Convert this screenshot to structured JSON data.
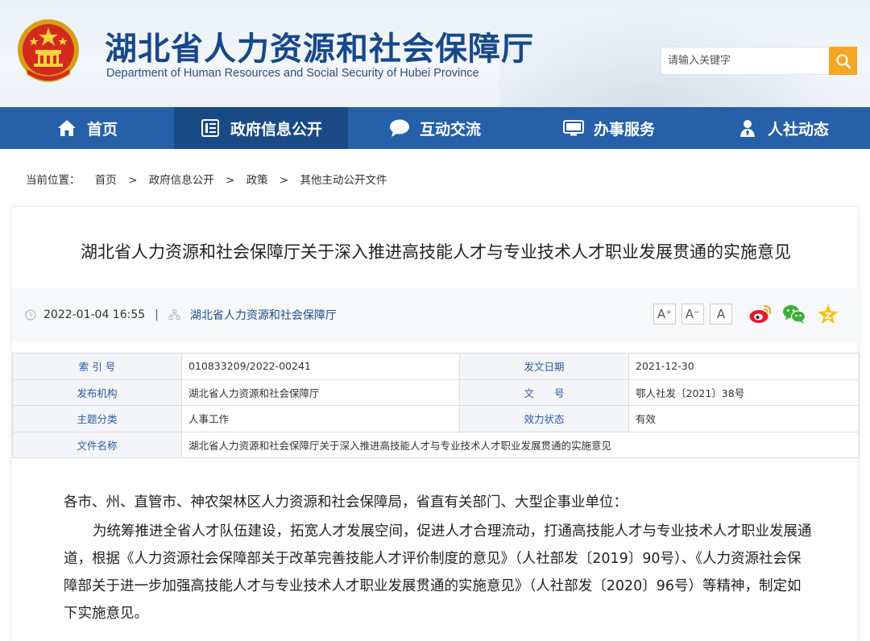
{
  "site": {
    "title": "湖北省人力资源和社会保障厅",
    "subtitle": "Department of Human Resources and Social Security of Hubei Province"
  },
  "search": {
    "placeholder": "请输入关键字"
  },
  "nav": {
    "items": [
      {
        "label": "首页",
        "icon": "home-icon"
      },
      {
        "label": "政府信息公开",
        "icon": "document-list-icon"
      },
      {
        "label": "互动交流",
        "icon": "chat-bubble-icon"
      },
      {
        "label": "办事服务",
        "icon": "monitor-icon"
      },
      {
        "label": "人社动态",
        "icon": "person-icon"
      }
    ],
    "active_index": 1
  },
  "breadcrumb": {
    "label": "当前位置：",
    "items": [
      "首页",
      "政府信息公开",
      "政策",
      "其他主动公开文件"
    ],
    "separator": ">"
  },
  "article": {
    "title": "湖北省人力资源和社会保障厅关于深入推进高技能人才与专业技术人才职业发展贯通的实施意见",
    "datetime": "2022-01-04 16:55",
    "divider": "|",
    "source": "湖北省人力资源和社会保障厅",
    "font_controls": [
      "A⁺",
      "A⁻",
      "A"
    ],
    "share": [
      "weibo-icon",
      "wechat-icon",
      "favorite-star-icon"
    ]
  },
  "info": {
    "index_label": "索 引 号",
    "index_value": "010833209/2022-00241",
    "date_label": "发文日期",
    "date_value": "2021-12-30",
    "org_label": "发布机构",
    "org_value": "湖北省人力资源和社会保障厅",
    "docno_label": "文　　号",
    "docno_value": "鄂人社发〔2021〕38号",
    "topic_label": "主题分类",
    "topic_value": "人事工作",
    "status_label": "效力状态",
    "status_value": "有效",
    "filename_label": "文件名称",
    "filename_value": "湖北省人力资源和社会保障厅关于深入推进高技能人才与专业技术人才职业发展贯通的实施意见"
  },
  "body": {
    "salutation": "各市、州、直管市、神农架林区人力资源和社会保障局，省直有关部门、大型企事业单位：",
    "paragraph1": "为统筹推进全省人才队伍建设，拓宽人才发展空间，促进人才合理流动，打通高技能人才与专业技术人才职业发展通道，根据《人力资源社会保障部关于改革完善技能人才评价制度的意见》（人社部发〔2019〕90号）、《人力资源社会保障部关于进一步加强高技能人才与专业技术人才职业发展贯通的实施意见》（人社部发〔2020〕96号）等精神，制定如下实施意见。"
  },
  "colors": {
    "nav_bg": "#2560a8",
    "nav_active": "#1a4a86",
    "title_blue": "#17488a",
    "search_button": "#f5a623"
  }
}
